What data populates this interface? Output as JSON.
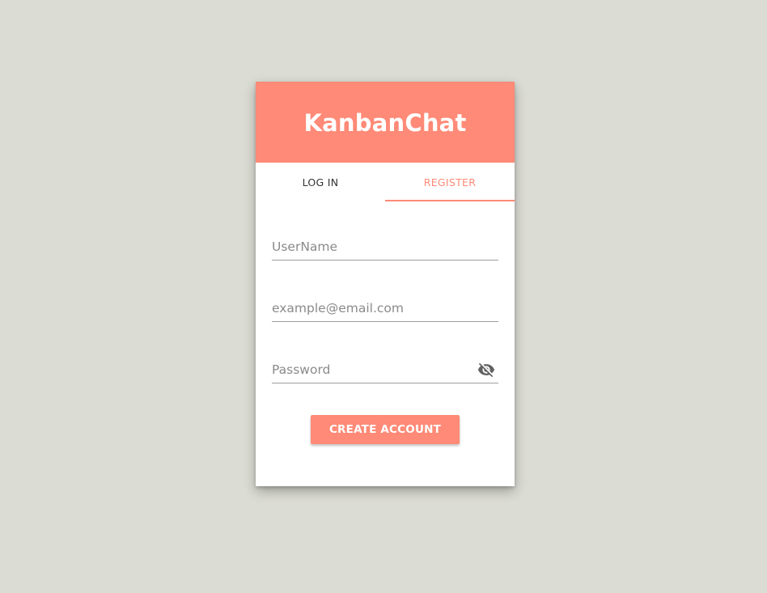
{
  "app": {
    "title": "KanbanChat"
  },
  "tabs": [
    {
      "label": "LOG IN",
      "active": false
    },
    {
      "label": "REGISTER",
      "active": true
    }
  ],
  "form": {
    "username": {
      "placeholder": "UserName",
      "value": ""
    },
    "email": {
      "placeholder": "example@email.com",
      "value": ""
    },
    "password": {
      "placeholder": "Password",
      "value": "",
      "toggle_icon": "eye-off-icon"
    },
    "submit_label": "CREATE ACCOUNT"
  },
  "colors": {
    "accent": "#ff8a77",
    "background": "#dbdcd4",
    "card": "#ffffff"
  }
}
